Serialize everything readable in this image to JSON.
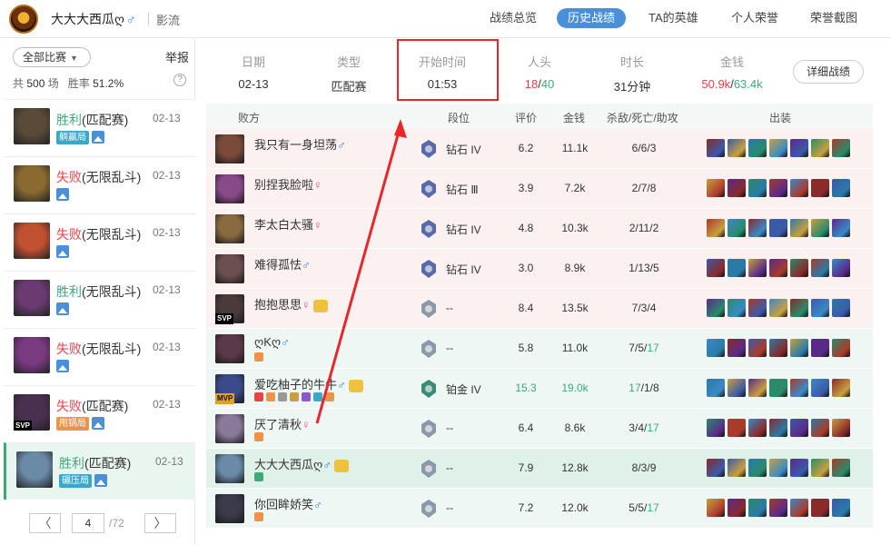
{
  "header": {
    "username": "大大大西瓜ღ",
    "gender": "♂",
    "server": "影流",
    "nav": [
      "战绩总览",
      "历史战绩",
      "TA的英雄",
      "个人荣誉",
      "荣誉截图"
    ],
    "active_nav": 1
  },
  "sidebar": {
    "filter": "全部比赛",
    "report": "举报",
    "total_label": "共",
    "total_count": "500",
    "total_unit": "场",
    "winrate_label": "胜率",
    "winrate": "51.2%",
    "matches": [
      {
        "result": "胜利",
        "mode": "(匹配赛)",
        "date": "02-13",
        "tag": "躺赢局",
        "tag_color": "#3aa8c8",
        "win": true,
        "avatar": "#5a4a38"
      },
      {
        "result": "失败",
        "mode": "(无限乱斗)",
        "date": "02-13",
        "tag": "",
        "tag_color": "",
        "win": false,
        "avatar": "#8a6a30"
      },
      {
        "result": "失败",
        "mode": "(无限乱斗)",
        "date": "02-13",
        "tag": "",
        "tag_color": "",
        "win": false,
        "avatar": "#c05030"
      },
      {
        "result": "胜利",
        "mode": "(无限乱斗)",
        "date": "02-13",
        "tag": "",
        "tag_color": "",
        "win": true,
        "avatar": "#6a3a70"
      },
      {
        "result": "失败",
        "mode": "(无限乱斗)",
        "date": "02-13",
        "tag": "",
        "tag_color": "",
        "win": false,
        "avatar": "#7a3a80"
      },
      {
        "result": "失败",
        "mode": "(匹配赛)",
        "date": "02-13",
        "tag": "甩锅局",
        "tag_color": "#e8944a",
        "win": false,
        "avatar": "#4a3050",
        "svp": "SVP"
      },
      {
        "result": "胜利",
        "mode": "(匹配赛)",
        "date": "02-13",
        "tag": "碾压局",
        "tag_color": "#3aa8c8",
        "win": true,
        "avatar": "#6a8aa8",
        "selected": true
      }
    ],
    "page": "4",
    "total_pages": "/72",
    "prev": "〈",
    "next": "〉"
  },
  "summary": {
    "date_label": "日期",
    "date": "02-13",
    "type_label": "类型",
    "type": "匹配赛",
    "start_label": "开始时间",
    "start": "01:53",
    "kills_label": "人头",
    "kills_a": "18",
    "kills_sep": "/",
    "kills_b": "40",
    "duration_label": "时长",
    "duration": "31分钟",
    "gold_label": "金钱",
    "gold_a": "50.9k",
    "gold_sep": "/",
    "gold_b": "63.4k",
    "detail_btn": "详细战绩"
  },
  "table_headers": {
    "team": "败方",
    "rank": "段位",
    "score": "评价",
    "gold": "金钱",
    "kda": "杀敌/死亡/助攻",
    "items": "出装"
  },
  "players": [
    {
      "name": "我只有一身坦荡",
      "g": "♂",
      "rank": "钻石 IV",
      "score": "6.2",
      "gold": "11.1k",
      "k": "6",
      "d": "6",
      "a": "3",
      "row": "lose",
      "avatar": "#7a4a3a",
      "rk": "#5a6aa8",
      "scoreCol": "#333",
      "hi": false
    },
    {
      "name": "别捏我脸啦",
      "g": "♀",
      "rank": "钻石 Ⅲ",
      "score": "3.9",
      "gold": "7.2k",
      "k": "2",
      "d": "7",
      "a": "8",
      "row": "lose",
      "avatar": "#8a4a8a",
      "rk": "#5a6aa8",
      "scoreCol": "#333",
      "hi": false
    },
    {
      "name": "李太白太骚",
      "g": "♀",
      "rank": "钻石 IV",
      "score": "4.8",
      "gold": "10.3k",
      "k": "2",
      "d": "11",
      "a": "2",
      "row": "lose",
      "avatar": "#8a6a40",
      "rk": "#5a6aa8",
      "scoreCol": "#333",
      "hi": false
    },
    {
      "name": "难得孤怯",
      "g": "♂",
      "rank": "钻石 IV",
      "score": "3.0",
      "gold": "8.9k",
      "k": "1",
      "d": "13",
      "a": "5",
      "row": "lose",
      "avatar": "#6a5050",
      "rk": "#5a6aa8",
      "scoreCol": "#333",
      "hi": false
    },
    {
      "name": "抱抱思思",
      "g": "♀",
      "rank": "--",
      "score": "8.4",
      "gold": "13.5k",
      "k": "7",
      "d": "3",
      "a": "4",
      "row": "lose",
      "avatar": "#4a3a3a",
      "rk": "#8a98a8",
      "scoreCol": "#333",
      "hi": false,
      "trophy": true,
      "badge": "SVP"
    },
    {
      "name": "ღKღ",
      "g": "♂",
      "rank": "--",
      "score": "5.8",
      "gold": "11.0k",
      "k": "7",
      "d": "5",
      "a": "17",
      "row": "win",
      "avatar": "#5a3a4a",
      "rk": "#8a98a8",
      "scoreCol": "#333",
      "hi": true,
      "tags": [
        "#e8944a"
      ]
    },
    {
      "name": "爱吃柚子的牛牛",
      "g": "♂",
      "rank": "铂金 IV",
      "score": "15.3",
      "gold": "19.0k",
      "k": "17",
      "d": "1",
      "a": "8",
      "row": "win",
      "avatar": "#3a4a8a",
      "rk": "#3a8a7a",
      "scoreCol": "#3fa97a",
      "goldCol": "#3fa97a",
      "kCol": "#3fa97a",
      "hi": false,
      "trophy": true,
      "badge": "MVP",
      "tags": [
        "#e8424b",
        "#e8944a",
        "#999",
        "#c8a040",
        "#8a5ac8",
        "#3aa8c8",
        "#e8944a"
      ]
    },
    {
      "name": "厌了清秋",
      "g": "♀",
      "rank": "--",
      "score": "6.4",
      "gold": "8.6k",
      "k": "3",
      "d": "4",
      "a": "17",
      "row": "win",
      "avatar": "#8a7a9a",
      "rk": "#8a98a8",
      "scoreCol": "#333",
      "hi": true,
      "tags": [
        "#e8944a"
      ]
    },
    {
      "name": "大大大西瓜ღ",
      "g": "♂",
      "rank": "--",
      "score": "7.9",
      "gold": "12.8k",
      "k": "8",
      "d": "3",
      "a": "9",
      "row": "me",
      "avatar": "#6a8aa8",
      "rk": "#8a98a8",
      "scoreCol": "#333",
      "hi": false,
      "trophy": true,
      "tags": [
        "#3fa97a"
      ]
    },
    {
      "name": "你回眸娇笑",
      "g": "♂",
      "rank": "--",
      "score": "7.2",
      "gold": "12.0k",
      "k": "5",
      "d": "5",
      "a": "17",
      "row": "win",
      "avatar": "#3a3a4a",
      "rk": "#8a98a8",
      "scoreCol": "#333",
      "hi": true,
      "tags": [
        "#e8944a"
      ]
    }
  ],
  "item_palette": [
    "#8a2a2a",
    "#3a5aa8",
    "#2a7aa8",
    "#c8a040",
    "#5a2a8a",
    "#2a8a6a",
    "#aa3a2a",
    "#3a8ac8"
  ]
}
